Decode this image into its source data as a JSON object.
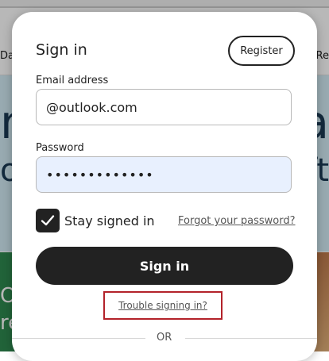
{
  "background": {
    "nav_left": "Da",
    "nav_right": "Re",
    "hero_left_1": "n",
    "hero_left_2": "o",
    "hero_right_1": "a",
    "hero_right_2": "ft",
    "bottom_left_1": "Or",
    "bottom_left_2": "re"
  },
  "modal": {
    "title": "Sign in",
    "register_label": "Register",
    "email": {
      "label": "Email address",
      "value": "@outlook.com"
    },
    "password": {
      "label": "Password",
      "value": "•••••••••••••"
    },
    "stay_signed_in": {
      "label": "Stay signed in",
      "checked": true
    },
    "forgot_link": "Forgot your password?",
    "signin_label": "Sign in",
    "trouble_link": "Trouble signing in?",
    "divider_text": "OR"
  },
  "colors": {
    "primary_button": "#222222",
    "password_fill": "#e8f0fe",
    "highlight_border": "#b3222a",
    "hero_bg": "#d3ecf5"
  }
}
